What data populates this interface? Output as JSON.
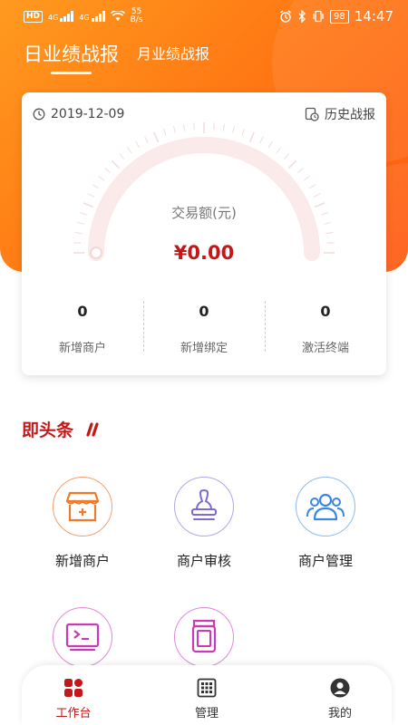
{
  "status_bar": {
    "hd": "HD",
    "net1": "4G",
    "net2": "4G",
    "speed_value": "55",
    "speed_unit": "B/s",
    "battery": "98",
    "time": "14:47"
  },
  "tabs": {
    "daily": "日业绩战报",
    "monthly": "月业绩战报"
  },
  "summary_card": {
    "date": "2019-12-09",
    "history_label": "历史战报",
    "gauge_label": "交易额(元)",
    "amount": "¥0.00",
    "gauge_fraction": 0,
    "stats": [
      {
        "value": "0",
        "label": "新增商户"
      },
      {
        "value": "0",
        "label": "新增绑定"
      },
      {
        "value": "0",
        "label": "激活终端"
      }
    ]
  },
  "headline": {
    "title": "即头条"
  },
  "actions": [
    {
      "label": "新增商户",
      "icon": "add-store-icon",
      "color": "#f07a2a"
    },
    {
      "label": "商户审核",
      "icon": "stamp-icon",
      "color": "#7a6bd6"
    },
    {
      "label": "商户管理",
      "icon": "users-icon",
      "color": "#3b86e0"
    },
    {
      "label": "",
      "icon": "terminal-icon",
      "color": "#c93bb4"
    },
    {
      "label": "",
      "icon": "pos-device-icon",
      "color": "#c93bb4"
    }
  ],
  "bottom_nav": [
    {
      "label": "工作台",
      "icon": "workbench-icon",
      "active": true
    },
    {
      "label": "管理",
      "icon": "grid-manage-icon",
      "active": false
    },
    {
      "label": "我的",
      "icon": "profile-icon",
      "active": false
    }
  ],
  "colors": {
    "brand_orange": "#ff7a14",
    "accent_red": "#c4171a"
  }
}
